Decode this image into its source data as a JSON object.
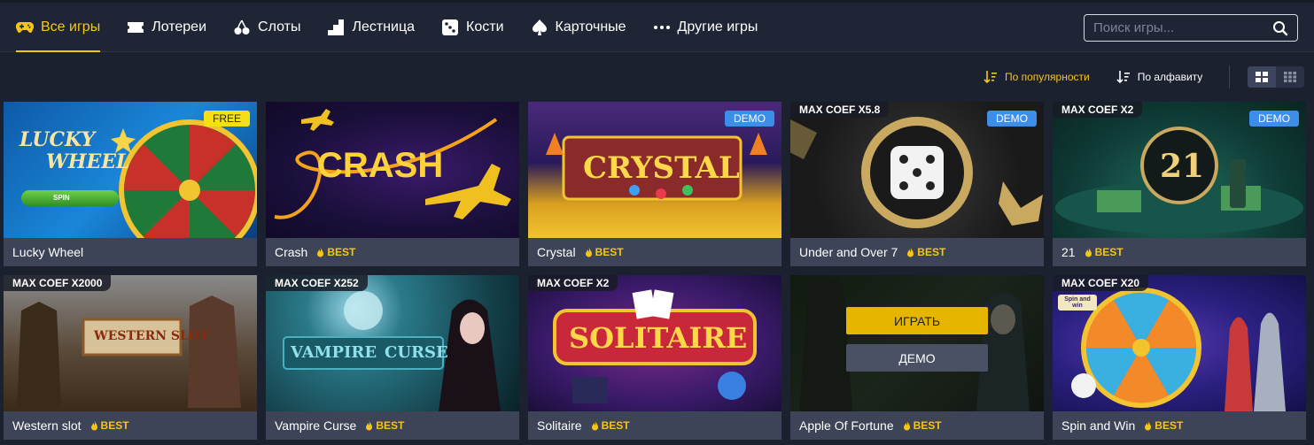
{
  "nav": {
    "tabs": [
      {
        "label": "Все игры",
        "icon": "gamepad-icon",
        "active": true
      },
      {
        "label": "Лотереи",
        "icon": "ticket-icon",
        "active": false
      },
      {
        "label": "Слоты",
        "icon": "cherry-icon",
        "active": false
      },
      {
        "label": "Лестница",
        "icon": "stairs-icon",
        "active": false
      },
      {
        "label": "Кости",
        "icon": "dice-icon",
        "active": false
      },
      {
        "label": "Карточные",
        "icon": "spade-icon",
        "active": false
      },
      {
        "label": "Другие игры",
        "icon": "dots-icon",
        "active": false
      }
    ],
    "search_placeholder": "Поиск игры..."
  },
  "sort": {
    "popular_label": "По популярности",
    "alpha_label": "По алфавиту",
    "active": "popular"
  },
  "colors": {
    "accent": "#f5c518",
    "background": "#1c2130",
    "card_footer": "#3d4457",
    "demo_badge": "#3d8ee8",
    "free_badge": "#f5e018"
  },
  "games": [
    {
      "name": "Lucky Wheel",
      "best": "",
      "badge": "FREE",
      "maxcoef": "",
      "art_text": [
        "LUCKY",
        "WHEEL"
      ],
      "art_extra": "SPIN"
    },
    {
      "name": "Crash",
      "best": "BEST",
      "badge": "",
      "maxcoef": "",
      "art_text": [
        "CRASH"
      ]
    },
    {
      "name": "Crystal",
      "best": "BEST",
      "badge": "DEMO",
      "maxcoef": "",
      "art_text": [
        "CRYSTAL"
      ]
    },
    {
      "name": "Under and Over 7",
      "best": "BEST",
      "badge": "DEMO",
      "maxcoef": "MAX COEF X5.8"
    },
    {
      "name": "21",
      "best": "BEST",
      "badge": "DEMO",
      "maxcoef": "MAX COEF X2",
      "art_text": [
        "21"
      ]
    },
    {
      "name": "Western slot",
      "best": "BEST",
      "badge": "",
      "maxcoef": "MAX COEF X2000",
      "art_text": [
        "WESTERN SLOT"
      ]
    },
    {
      "name": "Vampire Curse",
      "best": "BEST",
      "badge": "",
      "maxcoef": "MAX COEF X252",
      "art_text": [
        "VAMPIRE",
        "CURSE"
      ]
    },
    {
      "name": "Solitaire",
      "best": "BEST",
      "badge": "",
      "maxcoef": "MAX COEF X2",
      "art_text": [
        "SOLITAIRE"
      ]
    },
    {
      "name": "Apple Of Fortune",
      "best": "BEST",
      "badge": "",
      "maxcoef": "",
      "play_label": "ИГРАТЬ",
      "demo_label": "ДЕМО"
    },
    {
      "name": "Spin and Win",
      "best": "BEST",
      "badge": "",
      "maxcoef": "MAX COEF X20",
      "art_extra": "Spin and win"
    }
  ]
}
